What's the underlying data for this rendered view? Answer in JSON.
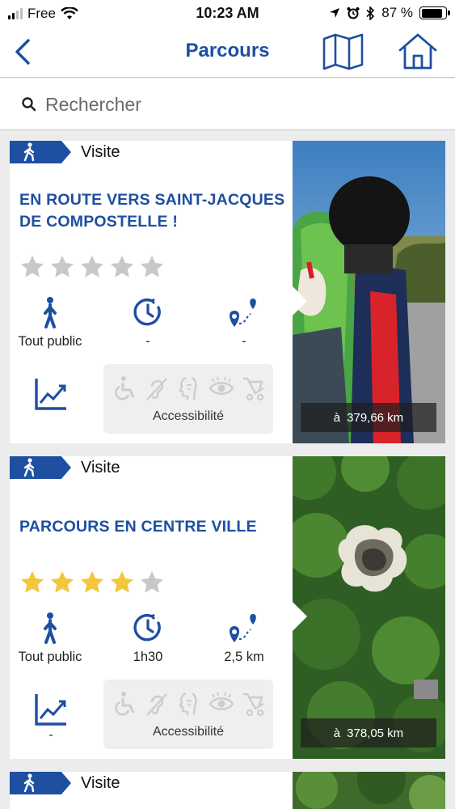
{
  "status_bar": {
    "carrier": "Free",
    "time": "10:23 AM",
    "battery_percent": "87 %",
    "battery_level": 0.87
  },
  "nav": {
    "title": "Parcours",
    "back_icon": "chevron-left-icon",
    "map_icon": "map-icon",
    "home_icon": "home-icon"
  },
  "search": {
    "placeholder": "Rechercher",
    "value": ""
  },
  "colors": {
    "brand_blue": "#1e4fa0",
    "star_filled": "#f3c63c",
    "star_empty": "#c8c8c8"
  },
  "routes": [
    {
      "type_label": "Visite",
      "title": "EN ROUTE VERS SAINT-JACQUES DE COMPOSTELLE !",
      "rating": 0,
      "audience": "Tout public",
      "duration": "-",
      "distance": "-",
      "difficulty": "",
      "accessibility_label": "Accessibilité",
      "distance_from_user_prefix": "à",
      "distance_from_user": "379,66 km"
    },
    {
      "type_label": "Visite",
      "title": "PARCOURS EN CENTRE VILLE",
      "rating": 4,
      "audience": "Tout public",
      "duration": "1h30",
      "distance": "2,5 km",
      "difficulty": "-",
      "accessibility_label": "Accessibilité",
      "distance_from_user_prefix": "à",
      "distance_from_user": "378,05 km"
    },
    {
      "type_label": "Visite"
    }
  ]
}
